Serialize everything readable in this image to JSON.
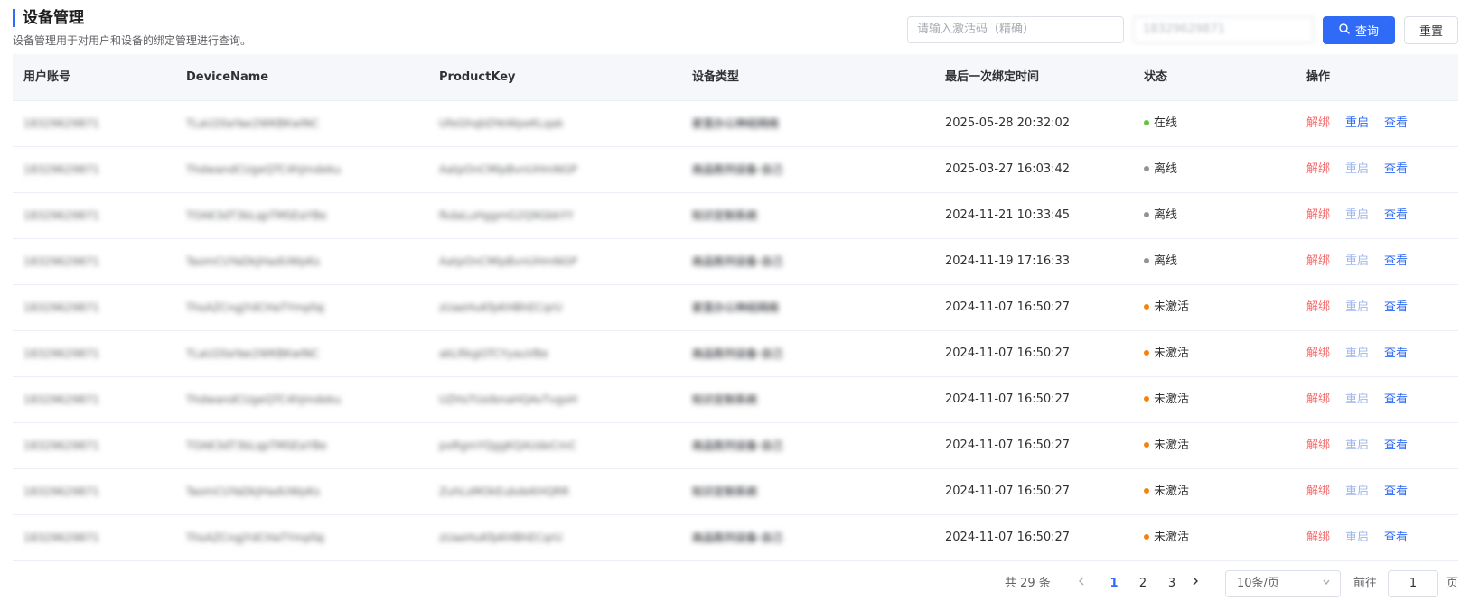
{
  "header": {
    "title": "设备管理",
    "subtitle": "设备管理用于对用户和设备的绑定管理进行查询。"
  },
  "search": {
    "code_placeholder": "请输入激活码（精确）",
    "account_value": "18329629871",
    "query_label": "查询",
    "reset_label": "重置"
  },
  "table": {
    "columns": [
      "用户账号",
      "DeviceName",
      "ProductKey",
      "设备类型",
      "最后一次绑定时间",
      "状态",
      "操作"
    ],
    "rows": [
      {
        "account": "18329629871",
        "device_name": "TLaU20aYae2WKBKwlNC",
        "product_key": "UfeGhqbDYeWpeKLqak",
        "type": "家里办公神经网络",
        "time": "2025-05-28 20:32:02",
        "status": "在线",
        "status_color": "#67c23a",
        "restart_enabled": true
      },
      {
        "account": "18329629871",
        "device_name": "ThdwandCUgeQTC4hJmdeku",
        "product_key": "AatpOnCMlpBvnUHmNGP",
        "type": "商品陈列设备·自己",
        "time": "2025-03-27 16:03:42",
        "status": "离线",
        "status_color": "#909399",
        "restart_enabled": false
      },
      {
        "account": "18329629871",
        "device_name": "TOAK3dT3bLqpTMSEaYBe",
        "product_key": "fkdaLuHggmG2Q9GbkYY",
        "type": "知识定制系统",
        "time": "2024-11-21 10:33:45",
        "status": "离线",
        "status_color": "#909399",
        "restart_enabled": false
      },
      {
        "account": "18329629871",
        "device_name": "TaomCUYaDkJHadUWpKs",
        "product_key": "AatpOnCMlpBvnUHmNGP",
        "type": "商品陈列设备·自己",
        "time": "2024-11-19 17:16:33",
        "status": "离线",
        "status_color": "#909399",
        "restart_enabled": false
      },
      {
        "account": "18329629871",
        "device_name": "ThsAZCngjYdCHaTYmpfaj",
        "product_key": "zUaeHuKfpKHBhECqrU",
        "type": "家里办公神经网络",
        "time": "2024-11-07 16:50:27",
        "status": "未激活",
        "status_color": "#f5820f",
        "restart_enabled": false
      },
      {
        "account": "18329629871",
        "device_name": "TLaU20aYae2WKBKwlNC",
        "product_key": "akLRkgGTCYyauVBe",
        "type": "商品陈列设备·自己",
        "time": "2024-11-07 16:50:27",
        "status": "未激活",
        "status_color": "#f5820f",
        "restart_enabled": false
      },
      {
        "account": "18329629871",
        "device_name": "ThdwandCUgeQTC4hJmdeku",
        "product_key": "UZHsTUolbnaHQAvTvgoH",
        "type": "知识定制系统",
        "time": "2024-11-07 16:50:27",
        "status": "未激活",
        "status_color": "#f5820f",
        "restart_enabled": false
      },
      {
        "account": "18329629871",
        "device_name": "TOAK3dT3bLqpTMSEaYBe",
        "product_key": "pxRgmYQggKQAUdeCmC",
        "type": "商品陈列设备·自己",
        "time": "2024-11-07 16:50:27",
        "status": "未激活",
        "status_color": "#f5820f",
        "restart_enabled": false
      },
      {
        "account": "18329629871",
        "device_name": "TaomCUYaDkJHadUWpKs",
        "product_key": "ZuhLsMOkEubdeKHQRR",
        "type": "知识定制系统",
        "time": "2024-11-07 16:50:27",
        "status": "未激活",
        "status_color": "#f5820f",
        "restart_enabled": false
      },
      {
        "account": "18329629871",
        "device_name": "ThsAZCngjYdCHaTYmpfaj",
        "product_key": "zUaeHuKfpKHBhECqrU",
        "type": "商品陈列设备·自己",
        "time": "2024-11-07 16:50:27",
        "status": "未激活",
        "status_color": "#f5820f",
        "restart_enabled": false
      }
    ],
    "actions": {
      "unbind": "解绑",
      "restart": "重启",
      "view": "查看"
    }
  },
  "pagination": {
    "total_label": "共 29 条",
    "prev_icon": "chevron-left-icon",
    "pages": [
      "1",
      "2",
      "3"
    ],
    "current_page": "1",
    "next_icon": "chevron-right-icon",
    "page_size": "10条/页",
    "goto_label": "前往",
    "goto_value": "1",
    "page_suffix": "页"
  }
}
